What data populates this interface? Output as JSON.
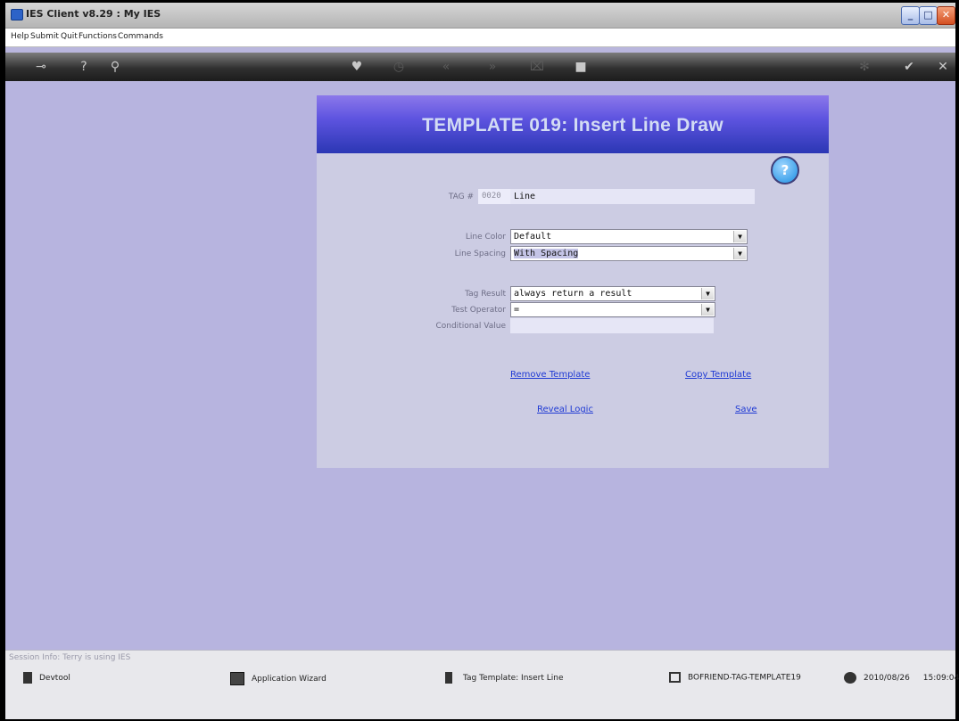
{
  "window": {
    "title": "IES Client v8.29 : My IES",
    "app_icon": "ies-logo-icon"
  },
  "window_controls": [
    {
      "icon": "minimize-icon",
      "glyph": "_"
    },
    {
      "icon": "maximize-icon",
      "glyph": "□"
    },
    {
      "icon": "close-icon",
      "glyph": "✕"
    }
  ],
  "menu": [
    "Help",
    "Submit",
    "Quit",
    "Functions",
    "Commands"
  ],
  "toolbar_icons": [
    "key-icon",
    "help-icon",
    "search-icon",
    "heart-icon",
    "clock-icon",
    "back-icon",
    "forward-icon",
    "trash-icon",
    "stop-icon",
    "gear-icon",
    "check-icon",
    "close-icon"
  ],
  "panel": {
    "title": "TEMPLATE 019:  Insert Line Draw",
    "help_glyph": "?",
    "tag_label": "TAG #",
    "tag_number": "0020",
    "tag_name": "Line",
    "line_color_label": "Line Color",
    "line_color_value": "Default",
    "line_spacing_label": "Line Spacing",
    "line_spacing_value": "With Spacing",
    "tag_result_label": "Tag Result",
    "tag_result_value": "always return a result",
    "test_operator_label": "Test Operator",
    "test_operator_value": "=",
    "conditional_value_label": "Conditional Value",
    "conditional_value": "",
    "links": {
      "remove": "Remove Template",
      "copy": "Copy Template",
      "reveal": "Reveal Logic",
      "save": "Save"
    }
  },
  "status": {
    "session": "Session Info: Terry is using IES",
    "devtool": "Devtool",
    "wizard": "Application Wizard",
    "tag_template": "Tag Template: Insert Line",
    "code": "BOFRIEND-TAG-TEMPLATE19",
    "date": "2010/08/26",
    "time": "15:09:04"
  },
  "colors": {
    "panel_header_top": "#8c78ea",
    "panel_header_bottom": "#2b37b4",
    "link": "#1f3ad4",
    "background": "#b7b4df"
  }
}
